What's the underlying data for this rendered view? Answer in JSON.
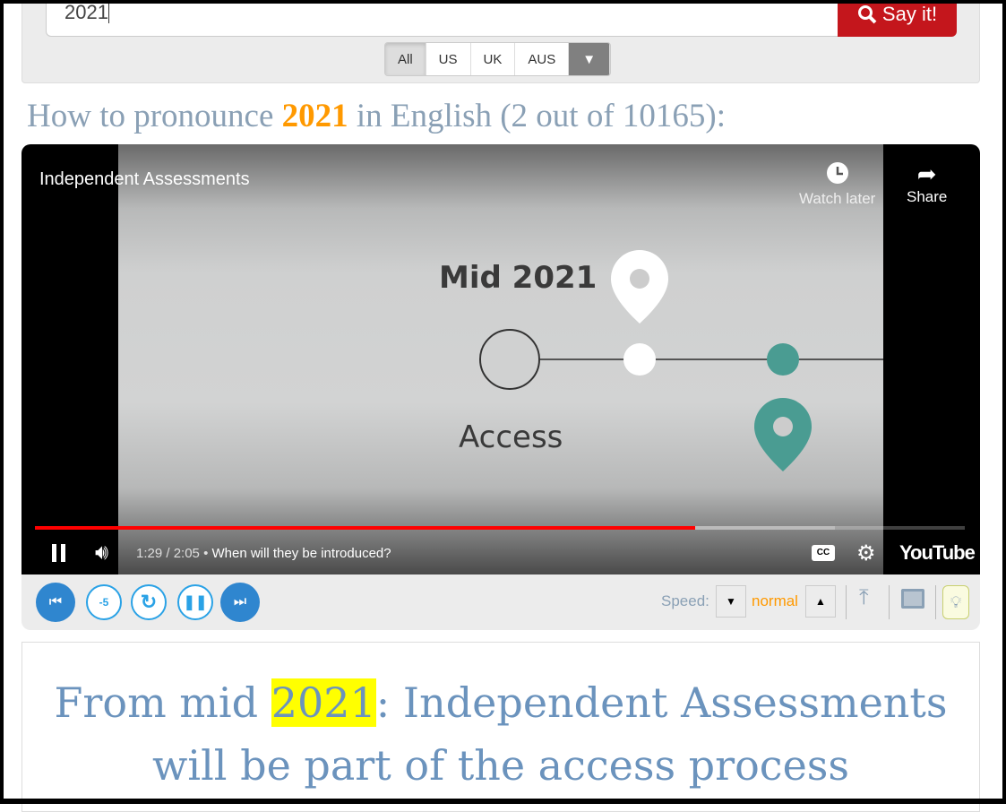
{
  "search": {
    "value": "2021",
    "button": "Say it!"
  },
  "accents": [
    "All",
    "US",
    "UK",
    "AUS"
  ],
  "heading": {
    "prefix": "How to pronounce ",
    "word": "2021",
    "suffix": " in English (2 out of 10165):"
  },
  "video": {
    "title": "Independent Assessments",
    "watch_later": "Watch later",
    "share": "Share",
    "time": "1:29 / 2:05",
    "chapter": "When will they be introduced?",
    "brand": "YouTube",
    "progress_fraction": 0.71,
    "scene": {
      "label1": "Mid 2021",
      "label2": "Access"
    }
  },
  "controls": {
    "speed_label": "Speed:",
    "speed_value": "normal",
    "rewind_label": "-5"
  },
  "sentence": {
    "pre": "From mid ",
    "highlight": "2021",
    "post": ": Independent Assessments will be part of the access process"
  },
  "colors": {
    "accent": "#ff9900",
    "brand_red": "#c4161c",
    "player_blue": "#2f86cf"
  }
}
